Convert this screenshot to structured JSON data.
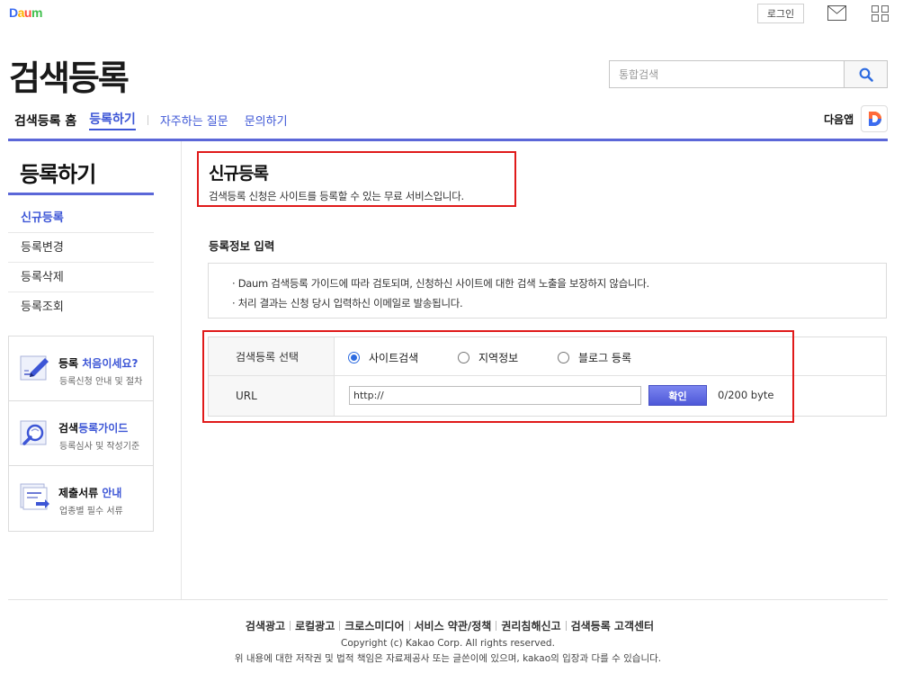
{
  "top_bar": {
    "logo": [
      "D",
      "a",
      "u",
      "m"
    ],
    "login_label": "로그인"
  },
  "header": {
    "title": "검색등록",
    "search_placeholder": "통합검색",
    "gnb": {
      "home": "검색등록 홈",
      "register": "등록하기",
      "faq": "자주하는 질문",
      "inquiry": "문의하기"
    },
    "daum_app_label": "다음앱"
  },
  "sidebar": {
    "title": "등록하기",
    "items": [
      {
        "label": "신규등록",
        "active": true
      },
      {
        "label": "등록변경",
        "active": false
      },
      {
        "label": "등록삭제",
        "active": false
      },
      {
        "label": "등록조회",
        "active": false
      }
    ],
    "banners": [
      {
        "title_a": "등록 ",
        "title_b": "처음이세요?",
        "sub": "등록신청 안내 및 절차"
      },
      {
        "title_a": "검색",
        "title_b": "등록가이드",
        "sub": "등록심사 및 작성기준"
      },
      {
        "title_a": "제출서류 ",
        "title_b": "안내",
        "sub": "업종별 필수 서류"
      }
    ]
  },
  "main": {
    "title": "신규등록",
    "description": "검색등록 신청은 사이트를 등록할 수 있는 무료 서비스입니다.",
    "section_title": "등록정보 입력",
    "notices": [
      "· Daum 검색등록 가이드에 따라 검토되며, 신청하신 사이트에 대한 검색 노출을 보장하지 않습니다.",
      "· 처리 결과는 신청 당시 입력하신 이메일로 발송됩니다."
    ],
    "form": {
      "type_label": "검색등록 선택",
      "options": [
        {
          "label": "사이트검색",
          "checked": true
        },
        {
          "label": "지역정보",
          "checked": false
        },
        {
          "label": "블로그 등록",
          "checked": false
        }
      ],
      "url_label": "URL",
      "url_value": "http://",
      "confirm_label": "확인",
      "byte_count": "0/200 byte"
    },
    "highlight_color": "#e01a1a",
    "accent_color": "#5b67d8"
  },
  "footer": {
    "links": [
      "검색광고",
      "로컬광고",
      "크로스미디어",
      "서비스 약관/정책",
      "권리침해신고",
      "검색등록 고객센터"
    ],
    "copyright": "Copyright (c) Kakao Corp. All rights reserved.",
    "disclaimer": "위 내용에 대한 저작권 및 법적 책임은 자료제공사 또는 글쓴이에 있으며, kakao의 입장과 다를 수 있습니다."
  }
}
